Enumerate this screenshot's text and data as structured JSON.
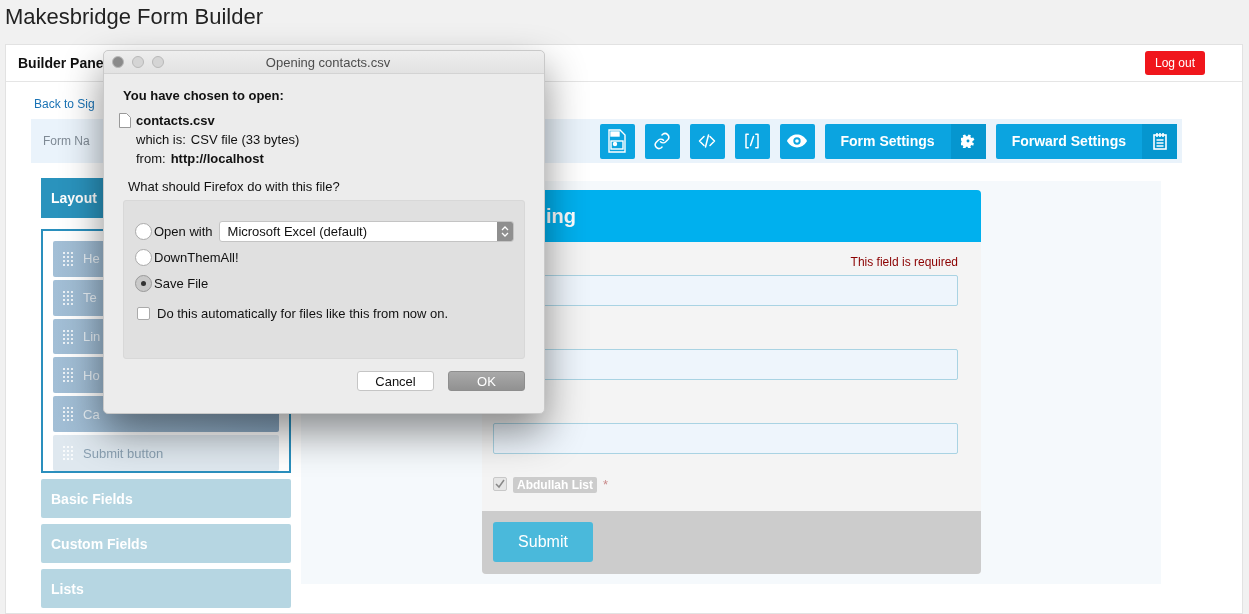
{
  "page_title": "Makesbridge Form Builder",
  "header": {
    "title": "Builder Pane",
    "logout": "Log out"
  },
  "back_link": "Back to Sig",
  "form_name": {
    "placeholder": "Form Na"
  },
  "toolbar": {
    "settings_buttons": [
      "Form Settings",
      "Forward Settings"
    ]
  },
  "sidebar": {
    "tab": "Layout",
    "layout_items": [
      {
        "label": "He",
        "disabled": false
      },
      {
        "label": "Te",
        "disabled": false
      },
      {
        "label": "Lin",
        "disabled": false
      },
      {
        "label": "Ho",
        "disabled": false
      },
      {
        "label": "Ca",
        "disabled": false
      },
      {
        "label": "Submit button",
        "disabled": true
      }
    ],
    "sections": [
      "Basic Fields",
      "Custom Fields",
      "Lists"
    ]
  },
  "form": {
    "heading": "ing",
    "error": "This field is required",
    "list_option": {
      "label": "Abdullah List",
      "checked": true,
      "required_mark": "*"
    },
    "submit": "Submit"
  },
  "dialog": {
    "title": "Opening contacts.csv",
    "intro": "You have chosen to open:",
    "filename": "contacts.csv",
    "which_is_label": "which is:",
    "which_is": "CSV file (33 bytes)",
    "from_label": "from:",
    "from": "http://localhost",
    "question": "What should Firefox do with this file?",
    "options": [
      {
        "label": "Open with",
        "selected": false,
        "app": "Microsoft Excel (default)"
      },
      {
        "label": "DownThemAll!",
        "selected": false
      },
      {
        "label": "Save File",
        "selected": true
      }
    ],
    "auto": {
      "label": "Do this automatically for files like this from now on.",
      "checked": false
    },
    "buttons": [
      "Cancel",
      "OK"
    ]
  }
}
